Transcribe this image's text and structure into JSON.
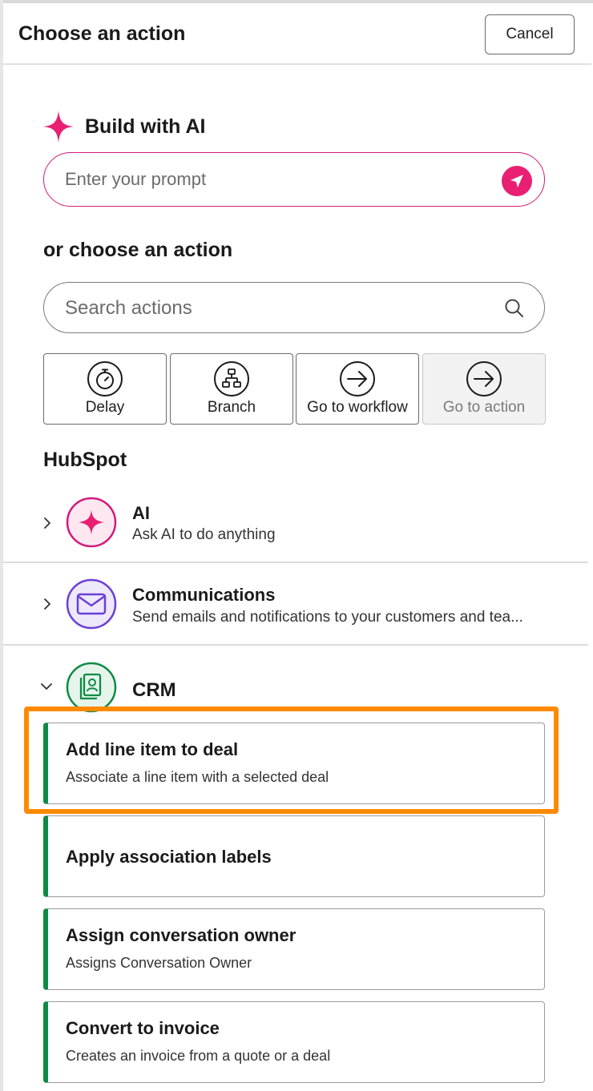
{
  "header": {
    "title": "Choose an action",
    "cancel_label": "Cancel"
  },
  "ai_builder": {
    "title": "Build with AI",
    "prompt_placeholder": "Enter your prompt",
    "icon": "sparkle-icon",
    "accent_color": "#e81f72"
  },
  "choose": {
    "heading": "or choose an action",
    "search_placeholder": "Search actions"
  },
  "quick_actions": [
    {
      "label": "Delay",
      "icon": "stopwatch-icon",
      "disabled": false
    },
    {
      "label": "Branch",
      "icon": "branch-icon",
      "disabled": false
    },
    {
      "label": "Go to workflow",
      "icon": "arrow-right-circle-icon",
      "disabled": false
    },
    {
      "label": "Go to action",
      "icon": "arrow-right-circle-icon",
      "disabled": true
    }
  ],
  "hubspot": {
    "heading": "HubSpot",
    "categories": [
      {
        "title": "AI",
        "description": "Ask AI to do anything",
        "icon": "sparkle-icon",
        "color": "#d11b7a",
        "expanded": false
      },
      {
        "title": "Communications",
        "description": "Send emails and notifications to your customers and tea...",
        "icon": "envelope-icon",
        "color": "#6b3fd4",
        "expanded": false
      },
      {
        "title": "CRM",
        "description": "",
        "icon": "contact-card-icon",
        "color": "#0f8a45",
        "expanded": true
      }
    ]
  },
  "crm_actions": [
    {
      "title": "Add line item to deal",
      "description": "Associate a line item with a selected deal",
      "highlighted": true
    },
    {
      "title": "Apply association labels",
      "description": ""
    },
    {
      "title": "Assign conversation owner",
      "description": "Assigns Conversation Owner"
    },
    {
      "title": "Convert to invoice",
      "description": "Creates an invoice from a quote or a deal"
    }
  ],
  "colors": {
    "crm_green": "#0f8a45",
    "highlight_orange": "#ff8a00"
  }
}
